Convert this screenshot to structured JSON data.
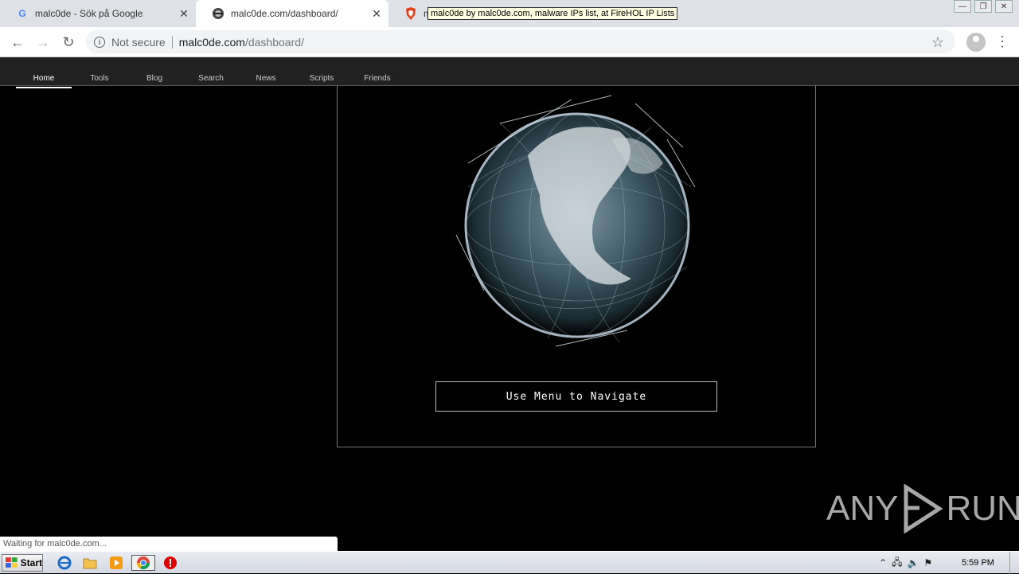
{
  "browser": {
    "tabs": [
      {
        "title": "malc0de - Sök på Google",
        "favicon": "google-icon"
      },
      {
        "title": "malc0de.com/dashboard/",
        "favicon": "malc0de-icon"
      },
      {
        "title": "mal",
        "favicon": "brave-shield-icon"
      }
    ],
    "tooltip": "malc0de by malc0de.com, malware IPs list, at FireHOL IP Lists",
    "security_label": "Not secure",
    "url_host": "malc0de.com",
    "url_path": "/dashboard/"
  },
  "site": {
    "nav": [
      "Home",
      "Tools",
      "Blog",
      "Search",
      "News",
      "Scripts",
      "Friends"
    ],
    "nav_hint": "Use Menu to Navigate"
  },
  "status_text": "Waiting for malc0de.com...",
  "watermark": {
    "left": "ANY",
    "right": "RUN"
  },
  "taskbar": {
    "start_label": "Start",
    "clock": "5:59 PM"
  }
}
